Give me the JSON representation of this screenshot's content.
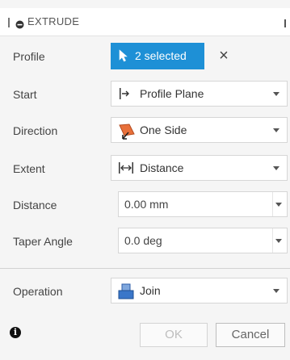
{
  "dialog": {
    "title": "EXTRUDE"
  },
  "rows": {
    "profile": {
      "label": "Profile",
      "selection": "2 selected",
      "clear_icon": "close-icon"
    },
    "start": {
      "label": "Start",
      "value": "Profile Plane",
      "icon": "profile-plane-icon"
    },
    "direction": {
      "label": "Direction",
      "value": "One Side",
      "icon": "one-side-icon"
    },
    "extent": {
      "label": "Extent",
      "value": "Distance",
      "icon": "distance-icon"
    },
    "distance": {
      "label": "Distance",
      "value": "0.00 mm"
    },
    "taper": {
      "label": "Taper Angle",
      "value": "0.0 deg"
    },
    "operation": {
      "label": "Operation",
      "value": "Join",
      "icon": "join-icon"
    }
  },
  "footer": {
    "info_icon": "info-icon",
    "ok_label": "OK",
    "cancel_label": "Cancel"
  },
  "colors": {
    "selection_blue": "#1e90d6",
    "direction_orange": "#e8703a",
    "join_blue": "#3a77c9"
  }
}
